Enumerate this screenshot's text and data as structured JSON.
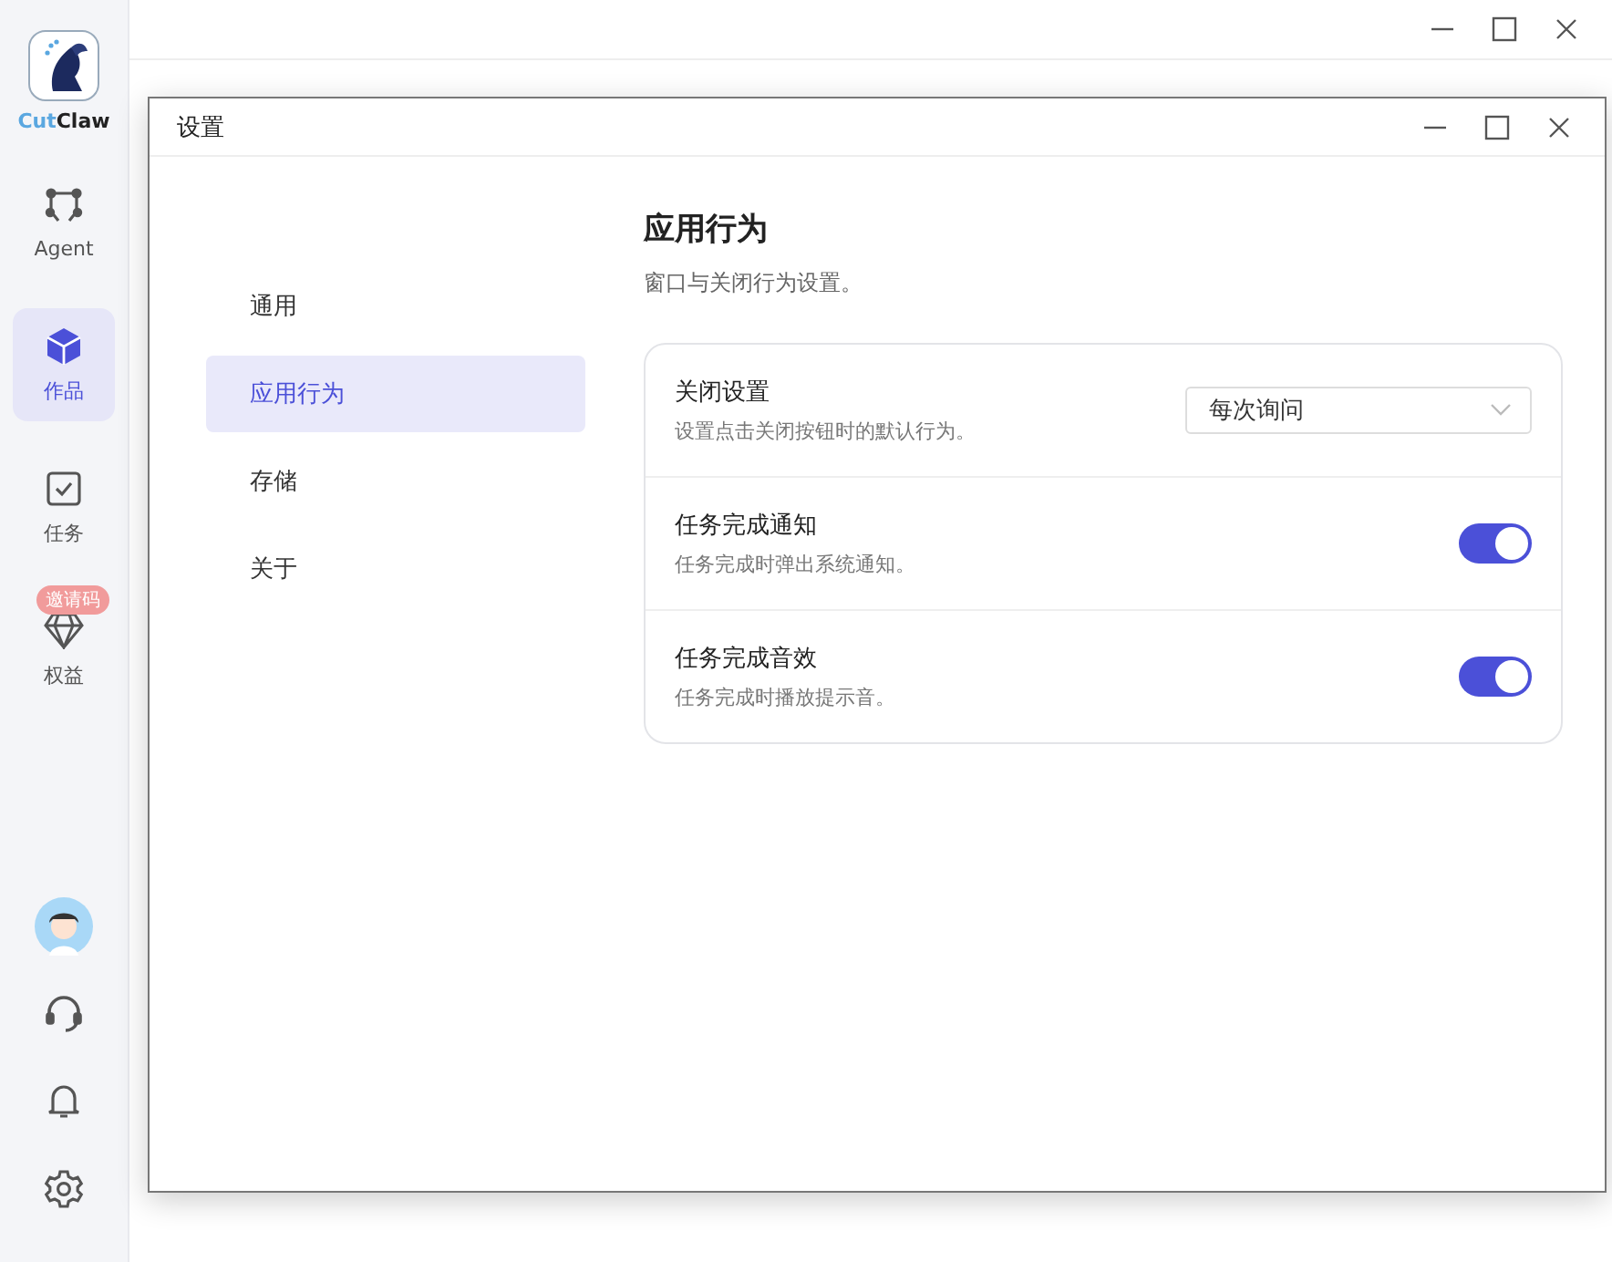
{
  "app": {
    "logo": {
      "prefix": "Cut",
      "suffix": "Claw"
    }
  },
  "sidebar": {
    "items": [
      {
        "label": "Agent",
        "selected": false
      },
      {
        "label": "作品",
        "selected": true
      },
      {
        "label": "任务",
        "selected": false
      },
      {
        "label": "权益",
        "selected": false,
        "badge": "邀请码"
      }
    ]
  },
  "dialog": {
    "title": "设置",
    "nav": [
      {
        "label": "通用",
        "selected": false
      },
      {
        "label": "应用行为",
        "selected": true
      },
      {
        "label": "存储",
        "selected": false
      },
      {
        "label": "关于",
        "selected": false
      }
    ],
    "heading": "应用行为",
    "subheading": "窗口与关闭行为设置。",
    "settings": [
      {
        "kind": "select",
        "title": "关闭设置",
        "description": "设置点击关闭按钮时的默认行为。",
        "value": "每次询问"
      },
      {
        "kind": "toggle",
        "title": "任务完成通知",
        "description": "任务完成时弹出系统通知。",
        "on": true
      },
      {
        "kind": "toggle",
        "title": "任务完成音效",
        "description": "任务完成时播放提示音。",
        "on": true
      }
    ]
  }
}
